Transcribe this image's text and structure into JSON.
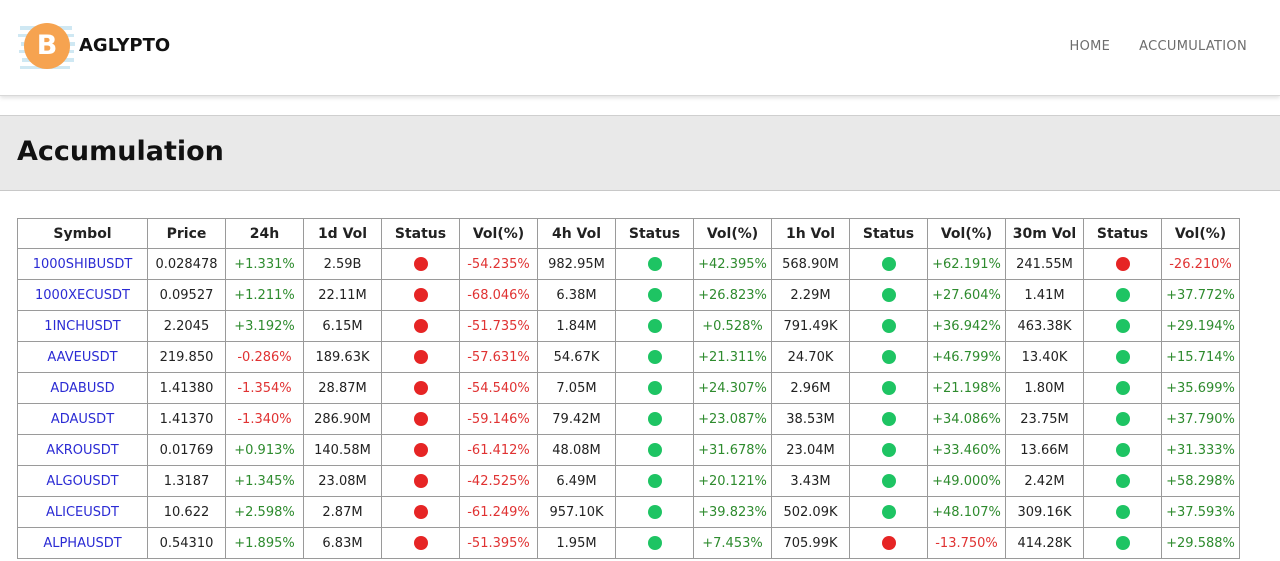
{
  "brand": {
    "name": "AGLYPTO",
    "logo_icon": "bitcoin-icon",
    "logo_glyph": "B",
    "logo_color": "#f6a350"
  },
  "nav": {
    "items": [
      {
        "label": "HOME"
      },
      {
        "label": "ACCUMULATION"
      }
    ]
  },
  "page": {
    "title": "Accumulation"
  },
  "colors": {
    "positive": "#2e8b2e",
    "negative": "#e03232",
    "status_green": "#1ec463",
    "status_red": "#e62525",
    "link": "#2b2bd4"
  },
  "table": {
    "headers": [
      "Symbol",
      "Price",
      "24h",
      "1d Vol",
      "Status",
      "Vol(%)",
      "4h Vol",
      "Status",
      "Vol(%)",
      "1h Vol",
      "Status",
      "Vol(%)",
      "30m Vol",
      "Status",
      "Vol(%)"
    ],
    "rows": [
      {
        "symbol": "1000SHIBUSDT",
        "price": "0.028478",
        "change_24h": "+1.331%",
        "vol_1d": "2.59B",
        "status_1d": "red",
        "volpct_1d": "-54.235%",
        "vol_4h": "982.95M",
        "status_4h": "green",
        "volpct_4h": "+42.395%",
        "vol_1h": "568.90M",
        "status_1h": "green",
        "volpct_1h": "+62.191%",
        "vol_30m": "241.55M",
        "status_30m": "red",
        "volpct_30m": "-26.210%"
      },
      {
        "symbol": "1000XECUSDT",
        "price": "0.09527",
        "change_24h": "+1.211%",
        "vol_1d": "22.11M",
        "status_1d": "red",
        "volpct_1d": "-68.046%",
        "vol_4h": "6.38M",
        "status_4h": "green",
        "volpct_4h": "+26.823%",
        "vol_1h": "2.29M",
        "status_1h": "green",
        "volpct_1h": "+27.604%",
        "vol_30m": "1.41M",
        "status_30m": "green",
        "volpct_30m": "+37.772%"
      },
      {
        "symbol": "1INCHUSDT",
        "price": "2.2045",
        "change_24h": "+3.192%",
        "vol_1d": "6.15M",
        "status_1d": "red",
        "volpct_1d": "-51.735%",
        "vol_4h": "1.84M",
        "status_4h": "green",
        "volpct_4h": "+0.528%",
        "vol_1h": "791.49K",
        "status_1h": "green",
        "volpct_1h": "+36.942%",
        "vol_30m": "463.38K",
        "status_30m": "green",
        "volpct_30m": "+29.194%"
      },
      {
        "symbol": "AAVEUSDT",
        "price": "219.850",
        "change_24h": "-0.286%",
        "vol_1d": "189.63K",
        "status_1d": "red",
        "volpct_1d": "-57.631%",
        "vol_4h": "54.67K",
        "status_4h": "green",
        "volpct_4h": "+21.311%",
        "vol_1h": "24.70K",
        "status_1h": "green",
        "volpct_1h": "+46.799%",
        "vol_30m": "13.40K",
        "status_30m": "green",
        "volpct_30m": "+15.714%"
      },
      {
        "symbol": "ADABUSD",
        "price": "1.41380",
        "change_24h": "-1.354%",
        "vol_1d": "28.87M",
        "status_1d": "red",
        "volpct_1d": "-54.540%",
        "vol_4h": "7.05M",
        "status_4h": "green",
        "volpct_4h": "+24.307%",
        "vol_1h": "2.96M",
        "status_1h": "green",
        "volpct_1h": "+21.198%",
        "vol_30m": "1.80M",
        "status_30m": "green",
        "volpct_30m": "+35.699%"
      },
      {
        "symbol": "ADAUSDT",
        "price": "1.41370",
        "change_24h": "-1.340%",
        "vol_1d": "286.90M",
        "status_1d": "red",
        "volpct_1d": "-59.146%",
        "vol_4h": "79.42M",
        "status_4h": "green",
        "volpct_4h": "+23.087%",
        "vol_1h": "38.53M",
        "status_1h": "green",
        "volpct_1h": "+34.086%",
        "vol_30m": "23.75M",
        "status_30m": "green",
        "volpct_30m": "+37.790%"
      },
      {
        "symbol": "AKROUSDT",
        "price": "0.01769",
        "change_24h": "+0.913%",
        "vol_1d": "140.58M",
        "status_1d": "red",
        "volpct_1d": "-61.412%",
        "vol_4h": "48.08M",
        "status_4h": "green",
        "volpct_4h": "+31.678%",
        "vol_1h": "23.04M",
        "status_1h": "green",
        "volpct_1h": "+33.460%",
        "vol_30m": "13.66M",
        "status_30m": "green",
        "volpct_30m": "+31.333%"
      },
      {
        "symbol": "ALGOUSDT",
        "price": "1.3187",
        "change_24h": "+1.345%",
        "vol_1d": "23.08M",
        "status_1d": "red",
        "volpct_1d": "-42.525%",
        "vol_4h": "6.49M",
        "status_4h": "green",
        "volpct_4h": "+20.121%",
        "vol_1h": "3.43M",
        "status_1h": "green",
        "volpct_1h": "+49.000%",
        "vol_30m": "2.42M",
        "status_30m": "green",
        "volpct_30m": "+58.298%"
      },
      {
        "symbol": "ALICEUSDT",
        "price": "10.622",
        "change_24h": "+2.598%",
        "vol_1d": "2.87M",
        "status_1d": "red",
        "volpct_1d": "-61.249%",
        "vol_4h": "957.10K",
        "status_4h": "green",
        "volpct_4h": "+39.823%",
        "vol_1h": "502.09K",
        "status_1h": "green",
        "volpct_1h": "+48.107%",
        "vol_30m": "309.16K",
        "status_30m": "green",
        "volpct_30m": "+37.593%"
      },
      {
        "symbol": "ALPHAUSDT",
        "price": "0.54310",
        "change_24h": "+1.895%",
        "vol_1d": "6.83M",
        "status_1d": "red",
        "volpct_1d": "-51.395%",
        "vol_4h": "1.95M",
        "status_4h": "green",
        "volpct_4h": "+7.453%",
        "vol_1h": "705.99K",
        "status_1h": "red",
        "volpct_1h": "-13.750%",
        "vol_30m": "414.28K",
        "status_30m": "green",
        "volpct_30m": "+29.588%"
      }
    ]
  }
}
